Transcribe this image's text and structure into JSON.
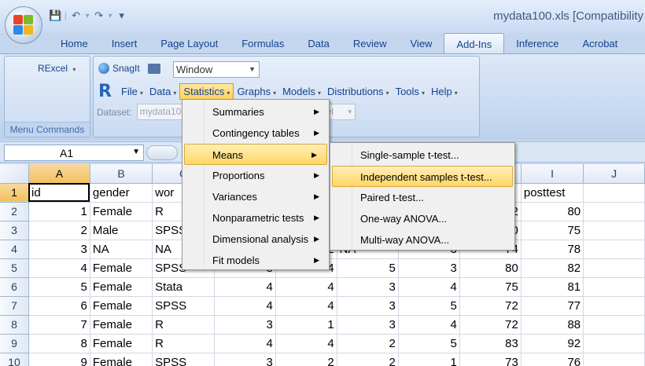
{
  "window": {
    "title": "mydata100.xls  [Compatibility"
  },
  "quick_access": {
    "save_icon": "save-icon",
    "undo_icon": "undo-icon",
    "redo_icon": "redo-icon"
  },
  "tabs": [
    "Home",
    "Insert",
    "Page Layout",
    "Formulas",
    "Data",
    "Review",
    "View",
    "Add-Ins",
    "Inference",
    "Acrobat"
  ],
  "active_tab": "Add-Ins",
  "ribbon": {
    "rexcel_label": "RExcel",
    "group_label": "Menu Commands",
    "snagit_label": "SnagIt",
    "window_select": "Window",
    "rcmdr_menus": [
      "File",
      "Data",
      "Statistics",
      "Graphs",
      "Models",
      "Distributions",
      "Tools",
      "Help"
    ],
    "dataset_label": "Dataset:",
    "dataset_value": "mydata100",
    "model_value": "del"
  },
  "formula_bar": {
    "cell_ref": "A1"
  },
  "grid": {
    "columns": [
      "A",
      "B",
      "C",
      "D",
      "E",
      "F",
      "G",
      "H",
      "I",
      "J"
    ],
    "rows": [
      {
        "n": "1",
        "cells": [
          "id",
          "gender",
          "wor",
          "",
          "",
          "",
          "",
          "",
          "posttest",
          ""
        ]
      },
      {
        "n": "2",
        "cells": [
          "1",
          "Female",
          "R",
          "",
          "",
          "",
          "",
          "72",
          "80",
          ""
        ]
      },
      {
        "n": "3",
        "cells": [
          "2",
          "Male",
          "SPSS",
          "",
          "",
          "",
          "",
          "70",
          "75",
          ""
        ]
      },
      {
        "n": "4",
        "cells": [
          "3",
          "NA",
          "NA",
          "",
          "2",
          "NA",
          "3",
          "74",
          "78",
          ""
        ]
      },
      {
        "n": "5",
        "cells": [
          "4",
          "Female",
          "SPSS",
          "3",
          "4",
          "5",
          "3",
          "80",
          "82",
          ""
        ]
      },
      {
        "n": "6",
        "cells": [
          "5",
          "Female",
          "Stata",
          "4",
          "4",
          "3",
          "4",
          "75",
          "81",
          ""
        ]
      },
      {
        "n": "7",
        "cells": [
          "6",
          "Female",
          "SPSS",
          "4",
          "4",
          "3",
          "5",
          "72",
          "77",
          ""
        ]
      },
      {
        "n": "8",
        "cells": [
          "7",
          "Female",
          "R",
          "3",
          "1",
          "3",
          "4",
          "72",
          "88",
          ""
        ]
      },
      {
        "n": "9",
        "cells": [
          "8",
          "Female",
          "R",
          "4",
          "4",
          "2",
          "5",
          "83",
          "92",
          ""
        ]
      },
      {
        "n": "10",
        "cells": [
          "9",
          "Female",
          "SPSS",
          "3",
          "2",
          "2",
          "1",
          "73",
          "76",
          ""
        ]
      }
    ]
  },
  "statistics_menu": {
    "items": [
      "Summaries",
      "Contingency tables",
      "Means",
      "Proportions",
      "Variances",
      "Nonparametric tests",
      "Dimensional analysis",
      "Fit models"
    ],
    "highlighted": "Means"
  },
  "means_menu": {
    "items": [
      "Single-sample t-test...",
      "Independent samples t-test...",
      "Paired t-test...",
      "One-way ANOVA...",
      "Multi-way ANOVA..."
    ],
    "highlighted": "Independent samples t-test..."
  }
}
